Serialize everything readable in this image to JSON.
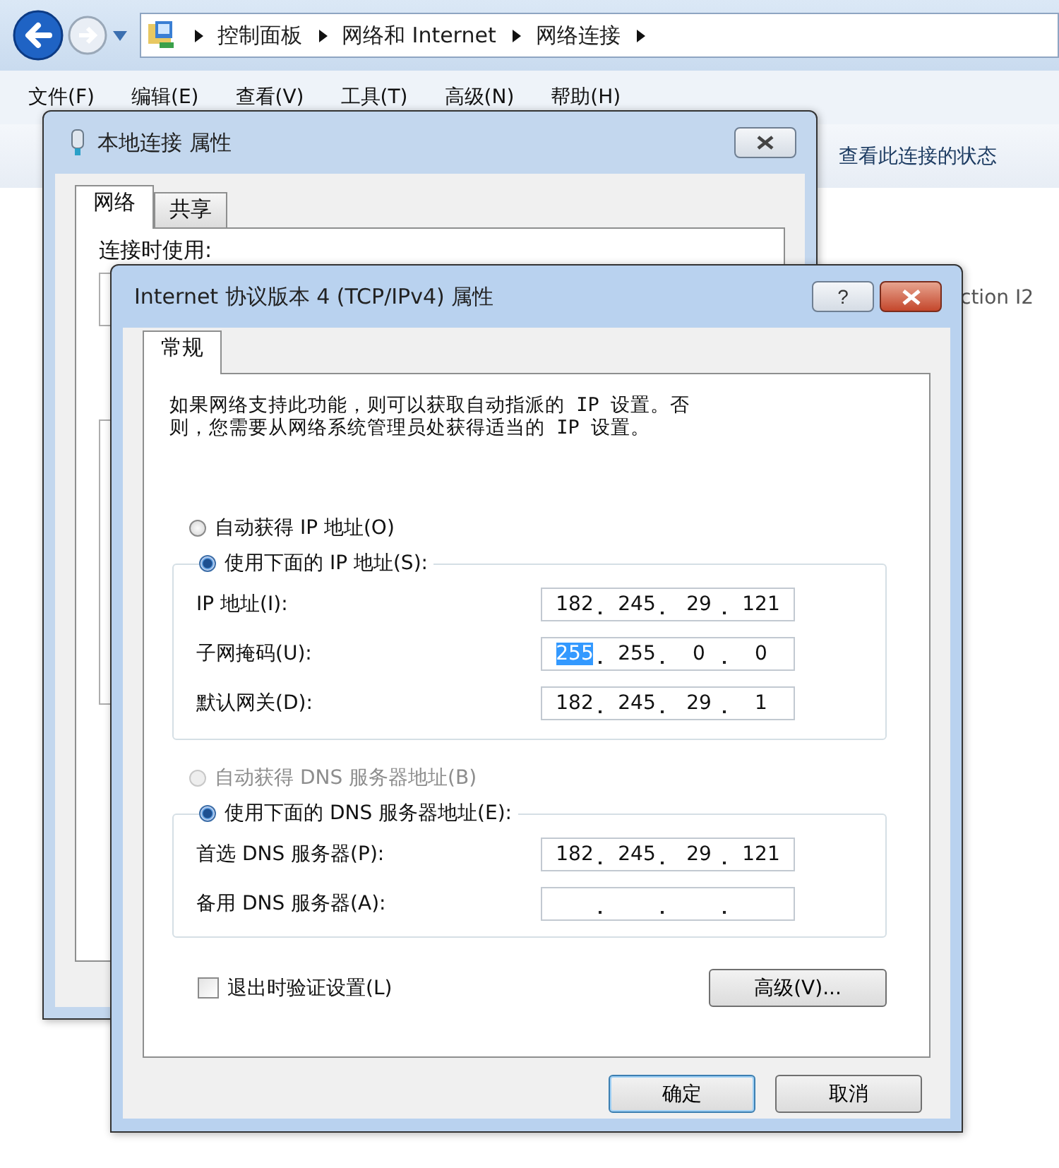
{
  "explorer": {
    "breadcrumbs": [
      "控制面板",
      "网络和 Internet",
      "网络连接"
    ],
    "menu": [
      "文件(F)",
      "编辑(E)",
      "查看(V)",
      "工具(T)",
      "高级(N)",
      "帮助(H)"
    ],
    "toolbar_action": "查看此连接的状态",
    "connection_name": "ction I2"
  },
  "local_connection_dialog": {
    "title": "本地连接 属性",
    "tabs": [
      {
        "label": "网络",
        "selected": true
      },
      {
        "label": "共享",
        "selected": false
      }
    ],
    "connect_using_label": "连接时使用:"
  },
  "ipv4_dialog": {
    "title": "Internet 协议版本 4 (TCP/IPv4) 属性",
    "help_button": "?",
    "tabs": [
      {
        "label": "常规",
        "selected": true
      }
    ],
    "description": "如果网络支持此功能，则可以获取自动指派的 IP 设置。否则，您需要从网络系统管理员处获得适当的 IP 设置。",
    "ip_options": [
      {
        "label": "自动获得 IP 地址(O)",
        "selected": false,
        "disabled": false
      },
      {
        "label": "使用下面的 IP 地址(S):",
        "selected": true,
        "disabled": false
      }
    ],
    "ip_fields": [
      {
        "label": "IP 地址(I):",
        "octets": [
          {
            "text": "182",
            "selected": false
          },
          {
            "text": "245",
            "selected": false
          },
          {
            "text": "29",
            "selected": false
          },
          {
            "text": "121",
            "selected": false
          }
        ]
      },
      {
        "label": "子网掩码(U):",
        "octets": [
          {
            "text": "255",
            "selected": true
          },
          {
            "text": "255",
            "selected": false
          },
          {
            "text": "0",
            "selected": false
          },
          {
            "text": "0",
            "selected": false
          }
        ]
      },
      {
        "label": "默认网关(D):",
        "octets": [
          {
            "text": "182",
            "selected": false
          },
          {
            "text": "245",
            "selected": false
          },
          {
            "text": "29",
            "selected": false
          },
          {
            "text": "1",
            "selected": false
          }
        ]
      }
    ],
    "dns_options": [
      {
        "label": "自动获得 DNS 服务器地址(B)",
        "selected": false,
        "disabled": true
      },
      {
        "label": "使用下面的 DNS 服务器地址(E):",
        "selected": true,
        "disabled": false
      }
    ],
    "dns_fields": [
      {
        "label": "首选 DNS 服务器(P):",
        "octets": [
          {
            "text": "182",
            "selected": false
          },
          {
            "text": "245",
            "selected": false
          },
          {
            "text": "29",
            "selected": false
          },
          {
            "text": "121",
            "selected": false
          }
        ]
      },
      {
        "label": "备用 DNS 服务器(A):"
      }
    ],
    "validate_on_exit": {
      "label": "退出时验证设置(L)",
      "checked": false
    },
    "advanced_button": "高级(V)...",
    "buttons": [
      {
        "label": "确定",
        "default": true
      },
      {
        "label": "取消",
        "default": false
      }
    ]
  }
}
